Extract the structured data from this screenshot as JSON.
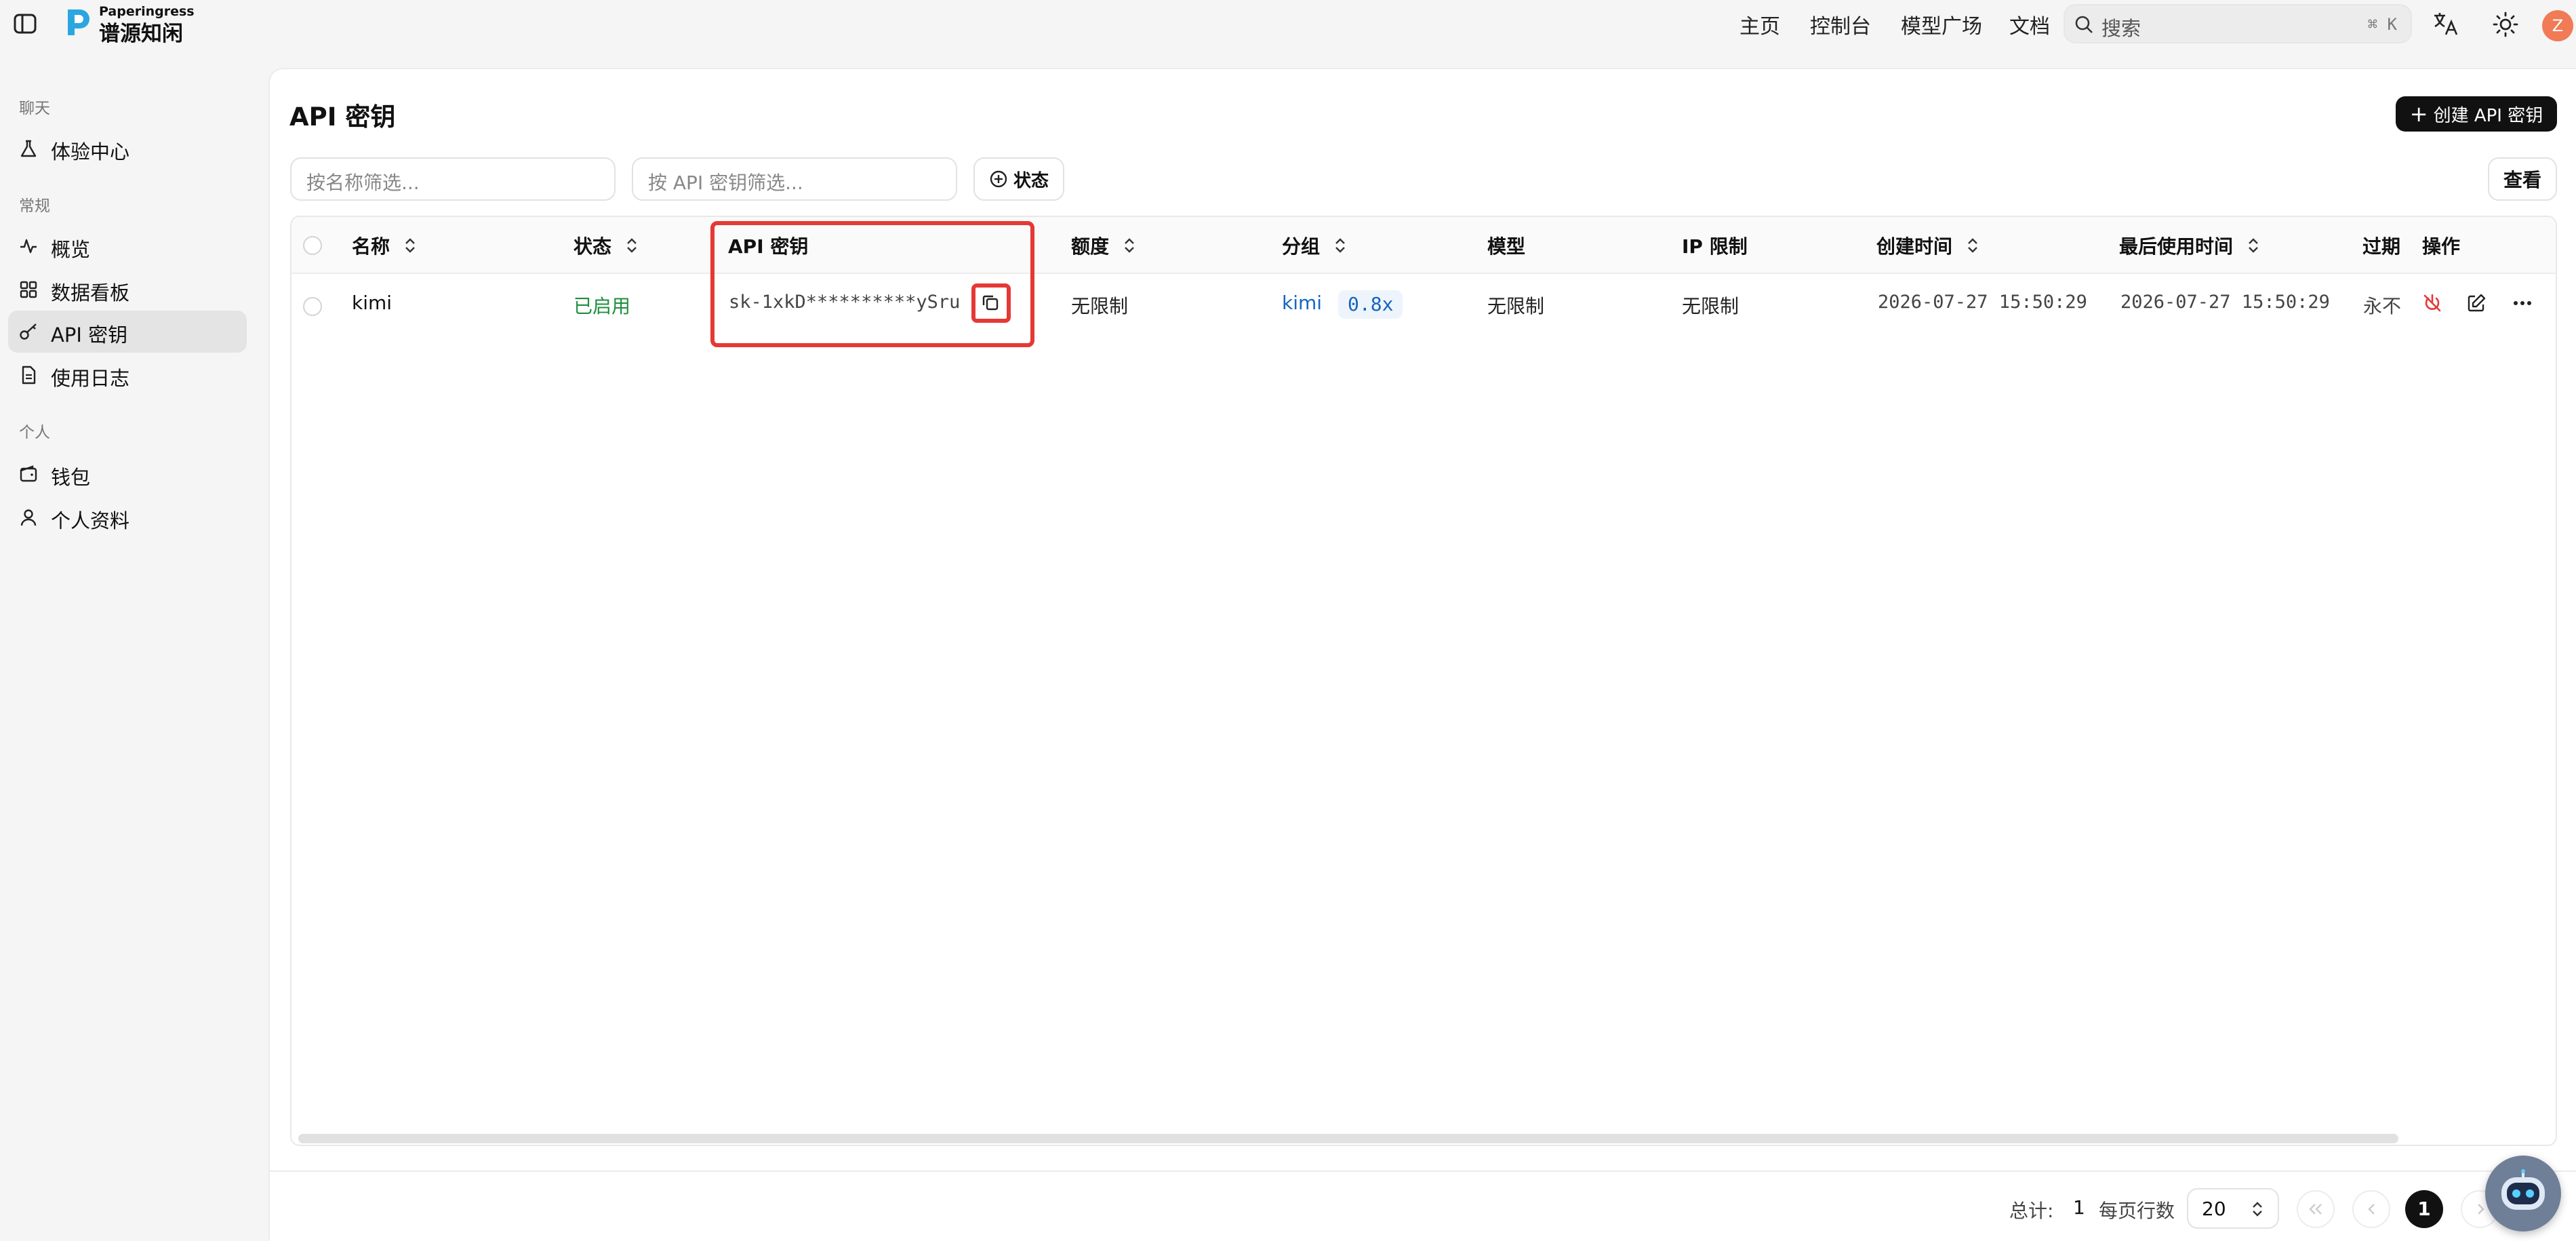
{
  "brand": {
    "small": "Paperingress",
    "name": "谱源知闲"
  },
  "topnav": {
    "items": [
      "主页",
      "控制台",
      "模型广场",
      "文档"
    ],
    "search_placeholder": "搜索",
    "search_shortcut": "⌘ K",
    "avatar_letter": "Z"
  },
  "sidebar": {
    "sections": [
      {
        "title": "聊天",
        "items": [
          {
            "label": "体验中心",
            "icon": "flask-icon"
          }
        ]
      },
      {
        "title": "常规",
        "items": [
          {
            "label": "概览",
            "icon": "activity-icon"
          },
          {
            "label": "数据看板",
            "icon": "dashboard-icon"
          },
          {
            "label": "API 密钥",
            "icon": "key-icon",
            "active": true
          },
          {
            "label": "使用日志",
            "icon": "document-icon"
          }
        ]
      },
      {
        "title": "个人",
        "items": [
          {
            "label": "钱包",
            "icon": "wallet-icon"
          },
          {
            "label": "个人资料",
            "icon": "user-icon"
          }
        ]
      }
    ]
  },
  "page": {
    "title": "API 密钥",
    "create_button": "创建 API 密钥",
    "filter_name_placeholder": "按名称筛选...",
    "filter_key_placeholder": "按 API 密钥筛选...",
    "status_filter": "状态",
    "view_button": "查看"
  },
  "table": {
    "columns": [
      "名称",
      "状态",
      "API 密钥",
      "额度",
      "分组",
      "模型",
      "IP 限制",
      "创建时间",
      "最后使用时间",
      "过期",
      "操作"
    ],
    "rows": [
      {
        "name": "kimi",
        "status": "已启用",
        "api_key": "sk-1xkD**********ySru",
        "quota": "无限制",
        "group": "kimi",
        "group_ratio": "0.8x",
        "models": "无限制",
        "ip_limit": "无限制",
        "created": "2026-07-27 15:50:29",
        "last_used": "2026-07-27 15:50:29",
        "expires": "永不"
      }
    ]
  },
  "footer": {
    "total_label": "总计:",
    "total": "1",
    "rows_per_page_label": "每页行数",
    "rows_per_page": "20",
    "current_page": "1"
  },
  "colors": {
    "status_enabled": "#1e8e3e",
    "group_link": "#1565c0",
    "highlight": "#e53935"
  }
}
